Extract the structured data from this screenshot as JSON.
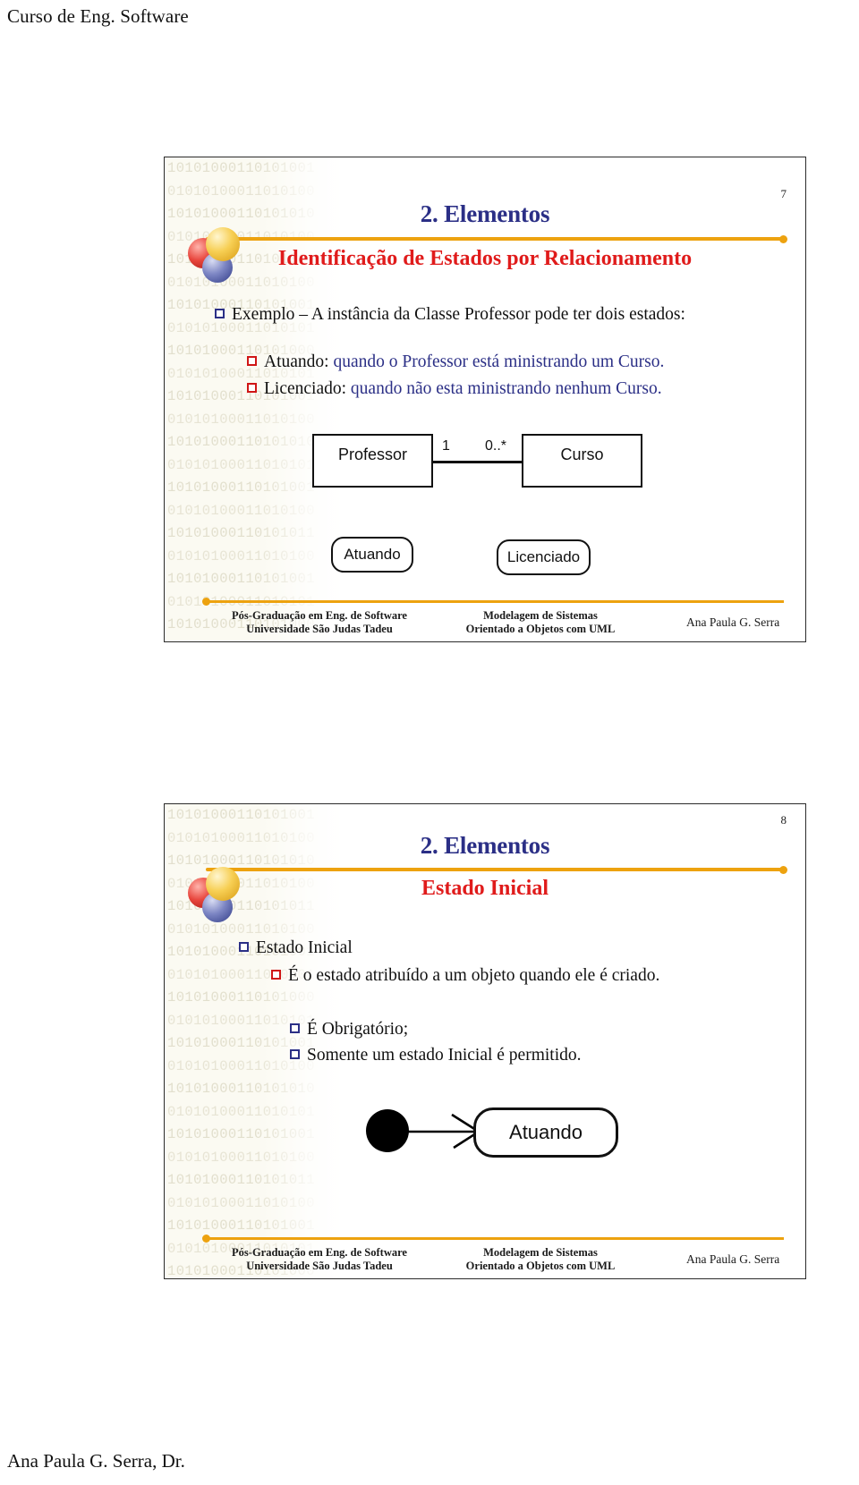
{
  "page": {
    "header": "Curso de Eng. Software",
    "footer": "Ana Paula G. Serra, Dr."
  },
  "binary_pattern": [
    "10101000110101001",
    "01010100011010100",
    "10101000110101010",
    "01010100011010100",
    "10101000110101011",
    "01010100011010100",
    "10101000110101001",
    "01010100011010101",
    "10101000110101000",
    "01010100011010101",
    "10101000110101001",
    "01010100011010100",
    "10101000110101010",
    "01010100011010101",
    "10101000110101001",
    "01010100011010100",
    "10101000110101011",
    "01010100011010100",
    "10101000110101001",
    "01010100011010101",
    "10101000110101000",
    "01010100011010100"
  ],
  "slides": [
    {
      "number": "7",
      "title": "2. Elementos",
      "subtitle": "Identificação de Estados por Relacionamento",
      "bullets": [
        {
          "level": 1,
          "marker": "blue",
          "text": "Exemplo – A instância da Classe Professor pode ter dois estados:"
        },
        {
          "level": 2,
          "marker": "red",
          "lead": "Atuando:",
          "rest": " quando o Professor está ministrando um Curso."
        },
        {
          "level": 2,
          "marker": "red",
          "lead": "Licenciado:",
          "rest": " quando não esta ministrando nenhum Curso."
        }
      ],
      "diagram": {
        "type": "uml-class-diagram",
        "classes": [
          {
            "name": "Professor"
          },
          {
            "name": "Curso"
          }
        ],
        "multiplicities": [
          {
            "label": "1"
          },
          {
            "label": "0..*"
          }
        ],
        "states": [
          {
            "name": "Atuando"
          },
          {
            "name": "Licenciado"
          }
        ]
      },
      "footer": {
        "left_line1": "Pós-Graduação em Eng. de Software",
        "left_line2": "Universidade São Judas Tadeu",
        "center_line1": "Modelagem de Sistemas",
        "center_line2": "Orientado a Objetos com UML",
        "author": "Ana Paula G. Serra"
      }
    },
    {
      "number": "8",
      "title": "2. Elementos",
      "subtitle": "Estado Inicial",
      "bullets": [
        {
          "level": 1,
          "marker": "blue",
          "text": "Estado Inicial",
          "underline": true
        },
        {
          "level": 2,
          "marker": "red",
          "text": "É o estado atribuído a um objeto quando ele é criado."
        },
        {
          "level": 2,
          "marker": "blue",
          "text": "É Obrigatório;"
        },
        {
          "level": 2,
          "marker": "blue",
          "text": "Somente um estado Inicial é permitido."
        }
      ],
      "diagram": {
        "type": "uml-state-machine",
        "initial_node": "filled-circle",
        "transition": "arrow",
        "states": [
          {
            "name": "Atuando"
          }
        ]
      },
      "footer": {
        "left_line1": "Pós-Graduação em Eng. de Software",
        "left_line2": "Universidade São Judas Tadeu",
        "center_line1": "Modelagem de Sistemas",
        "center_line2": "Orientado a Objetos com UML",
        "author": "Ana Paula G. Serra"
      }
    }
  ],
  "colors": {
    "title_blue": "#2b2f86",
    "subtitle_red": "#e01b1b",
    "rule_orange": "#eda20f",
    "watermark": "#e2dfcd"
  }
}
